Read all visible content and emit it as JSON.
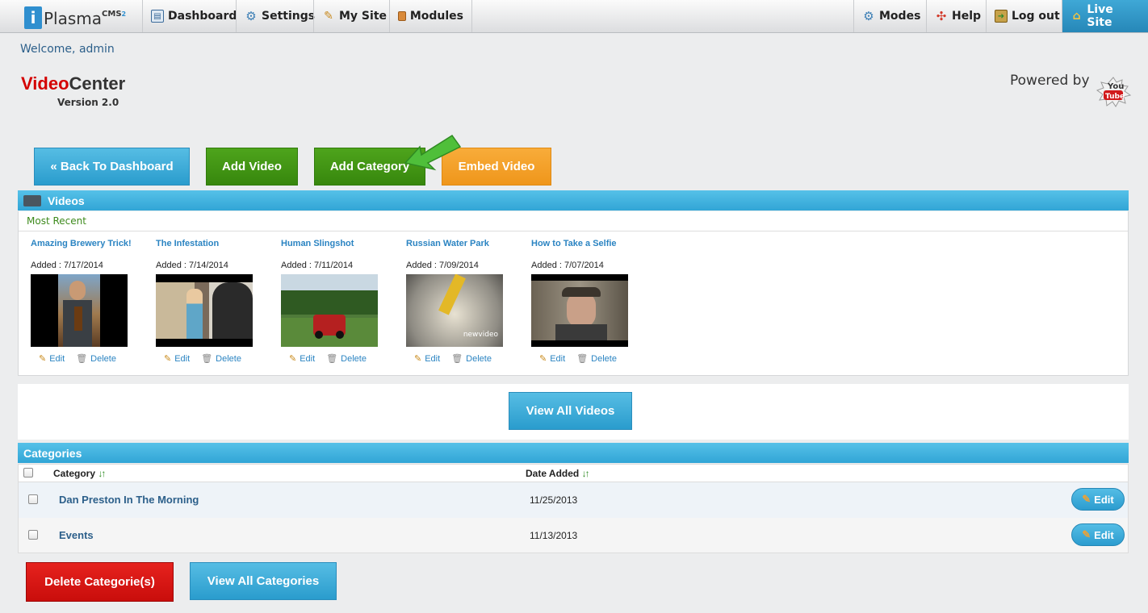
{
  "topbar": {
    "logo_text": "Plasma",
    "logo_sup": "CMS",
    "logo_sup2": "2",
    "nav_left": [
      {
        "label": "Dashboard",
        "icon": "dashboard-icon"
      },
      {
        "label": "Settings",
        "icon": "gear-icon"
      },
      {
        "label": "My Site",
        "icon": "pencil-page-icon"
      },
      {
        "label": "Modules",
        "icon": "modules-icon"
      }
    ],
    "nav_right": [
      {
        "label": "Modes",
        "icon": "gears-icon"
      },
      {
        "label": "Help",
        "icon": "lifebuoy-icon"
      },
      {
        "label": "Log out",
        "icon": "logout-icon"
      },
      {
        "label": "Live Site",
        "icon": "home-icon"
      }
    ]
  },
  "welcome": "Welcome, admin",
  "module": {
    "title_red": "Video",
    "title_rest": "Center",
    "version": "Version 2.0",
    "powered_by": "Powered by",
    "youtube_you": "You",
    "youtube_tube": "Tube"
  },
  "actions": {
    "back": "« Back To Dashboard",
    "add_video": "Add Video",
    "add_category": "Add Category",
    "embed_video": "Embed Video"
  },
  "videos": {
    "header": "Videos",
    "subheader": "Most Recent",
    "edit_label": "Edit",
    "delete_label": "Delete",
    "items": [
      {
        "title": "Amazing Brewery Trick!",
        "added": "Added : 7/17/2014"
      },
      {
        "title": "The Infestation",
        "added": "Added : 7/14/2014"
      },
      {
        "title": "Human Slingshot",
        "added": "Added : 7/11/2014"
      },
      {
        "title": "Russian Water Park",
        "added": "Added : 7/09/2014",
        "watermark": "newvideo"
      },
      {
        "title": "How to Take a Selfie",
        "added": "Added : 7/07/2014"
      }
    ],
    "view_all": "View All Videos"
  },
  "categories": {
    "header": "Categories",
    "col_category": "Category",
    "col_date": "Date Added",
    "edit_label": "Edit",
    "rows": [
      {
        "name": "Dan Preston In The Morning",
        "date": "11/25/2013"
      },
      {
        "name": "Events",
        "date": "11/13/2013"
      }
    ],
    "delete_btn": "Delete Categorie(s)",
    "view_all": "View All Categories"
  },
  "colors": {
    "accent_blue": "#31a5d6",
    "green": "#3d8a1c",
    "orange": "#f29c22",
    "red": "#d40000"
  }
}
